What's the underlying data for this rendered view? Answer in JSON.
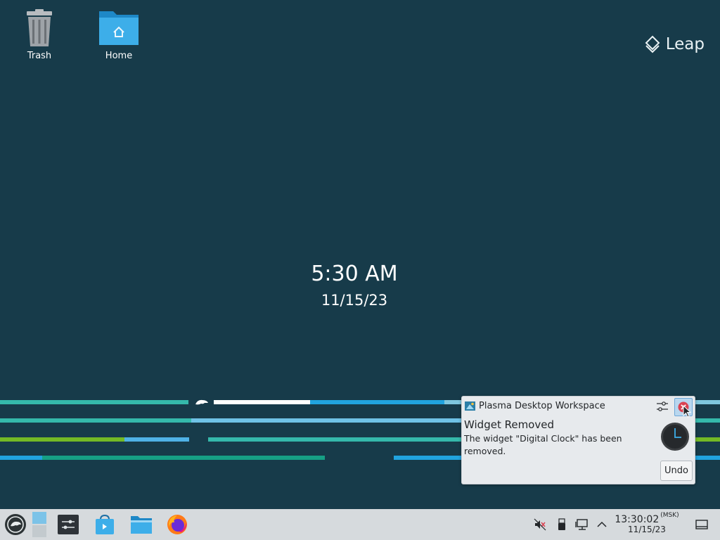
{
  "desktop": {
    "icons": [
      {
        "label": "Trash",
        "icon": "trash-icon"
      },
      {
        "label": "Home",
        "icon": "home-folder-icon"
      }
    ],
    "logo_text": "Leap"
  },
  "clock_widget": {
    "time": "5:30 AM",
    "date": "11/15/23"
  },
  "notification": {
    "app_name": "Plasma Desktop Workspace",
    "title": "Widget Removed",
    "body": "The widget \"Digital Clock\" has been removed.",
    "action_label": "Undo",
    "icons": [
      "plasma-app-icon",
      "configure-icon",
      "close-icon",
      "clock-icon"
    ]
  },
  "taskbar": {
    "launchers": [
      "opensuse-menu-icon",
      "pager-icon",
      "settings-icon",
      "discover-store-icon",
      "dolphin-files-icon",
      "firefox-icon"
    ],
    "tray_icons": [
      "volume-muted-icon",
      "usb-device-icon",
      "network-wired-icon",
      "expand-tray-icon"
    ],
    "clock_time": "13:30:02",
    "clock_tz": "(MSK)",
    "clock_date": "11/15/23",
    "show_desktop_icon": "show-desktop-icon"
  },
  "colors": {
    "background": "#173b4a",
    "stripe_teal": "#35b9ab",
    "stripe_blue": "#21a4df",
    "stripe_green": "#73ba25",
    "panel": "#d6dadd"
  }
}
